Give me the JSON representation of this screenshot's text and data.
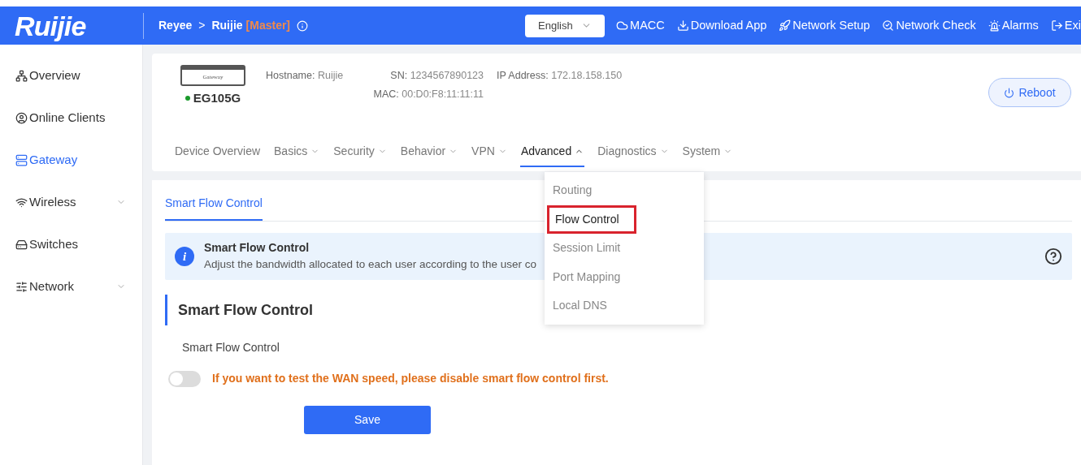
{
  "header": {
    "logo": "Ruijie",
    "breadcrumb": [
      "Reyee",
      "Ruijie"
    ],
    "separator": ">",
    "role": "[Master]",
    "language": "English",
    "actions": [
      {
        "kind": "cloud",
        "label": "MACC"
      },
      {
        "kind": "download",
        "label": "Download App"
      },
      {
        "kind": "rocket",
        "label": "Network Setup"
      },
      {
        "kind": "check",
        "label": "Network Check"
      },
      {
        "kind": "alarm",
        "label": "Alarms"
      },
      {
        "kind": "exit",
        "label": "Exi"
      }
    ]
  },
  "sidebar": {
    "items": [
      {
        "kind": "topology",
        "label": "Overview",
        "selected": false,
        "expandable": false
      },
      {
        "kind": "user",
        "label": "Online Clients",
        "selected": false,
        "expandable": false
      },
      {
        "kind": "gateway",
        "label": "Gateway",
        "selected": true,
        "expandable": false
      },
      {
        "kind": "wifi",
        "label": "Wireless",
        "selected": false,
        "expandable": true
      },
      {
        "kind": "switch",
        "label": "Switches",
        "selected": false,
        "expandable": false
      },
      {
        "kind": "network",
        "label": "Network",
        "selected": false,
        "expandable": true
      }
    ]
  },
  "device": {
    "image_label": "Gateway",
    "model": "EG105G",
    "online": true,
    "hostname_label": "Hostname:",
    "hostname": "Ruijie",
    "sn_label": "SN:",
    "sn": "1234567890123",
    "mac_label": "MAC:",
    "mac": "00:D0:F8:11:11:11",
    "ip_label": "IP Address:",
    "ip": "172.18.158.150",
    "reboot": "Reboot"
  },
  "nav": [
    {
      "kind": "link",
      "label": "Device Overview",
      "selected": false
    },
    {
      "kind": "menu",
      "label": "Basics",
      "selected": false,
      "expanded": false
    },
    {
      "kind": "menu",
      "label": "Security",
      "selected": false,
      "expanded": false
    },
    {
      "kind": "menu",
      "label": "Behavior",
      "selected": false,
      "expanded": false
    },
    {
      "kind": "menu",
      "label": "VPN",
      "selected": false,
      "expanded": false
    },
    {
      "kind": "menu",
      "label": "Advanced",
      "selected": true,
      "expanded": true
    },
    {
      "kind": "menu",
      "label": "Diagnostics",
      "selected": false,
      "expanded": false
    },
    {
      "kind": "menu",
      "label": "System",
      "selected": false,
      "expanded": false
    }
  ],
  "menu": [
    {
      "label": "Routing",
      "selected": false,
      "annotated": false
    },
    {
      "label": "Flow Control",
      "selected": true,
      "annotated": true
    },
    {
      "label": "Session Limit",
      "selected": false,
      "annotated": false
    },
    {
      "label": "Port Mapping",
      "selected": false,
      "annotated": false
    },
    {
      "label": "Local DNS",
      "selected": false,
      "annotated": false
    }
  ],
  "page": {
    "tabs": [
      {
        "label": "Smart Flow Control",
        "selected": true
      }
    ],
    "banner": {
      "icon": "i",
      "title": "Smart Flow Control",
      "text": "Adjust the bandwidth allocated to each user according to the user co"
    },
    "section_title": "Smart Flow Control",
    "field_label": "Smart Flow Control",
    "toggle_on": false,
    "warning": "If you want to test the WAN speed, please disable smart flow control first.",
    "save": "Save"
  }
}
